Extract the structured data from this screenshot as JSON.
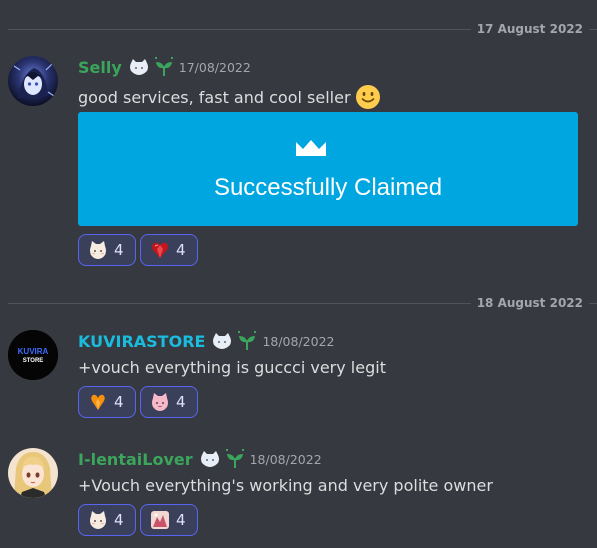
{
  "dividers": [
    {
      "date": "17 August 2022"
    },
    {
      "date": "18 August 2022"
    }
  ],
  "messages": [
    {
      "username": "Selly",
      "username_color": "#3ba55c",
      "timestamp": "17/08/2022",
      "text": "good services, fast and cool seller",
      "emoji": "slightly-smiling-face",
      "embed": {
        "title": "Successfully Claimed",
        "color": "#00a6df",
        "icon": "crown-icon"
      },
      "reactions": [
        {
          "emoji": "cat-face",
          "count": "4"
        },
        {
          "emoji": "red-heart-gem",
          "count": "4"
        }
      ]
    },
    {
      "username": "KUVIRASTORE",
      "username_color": "#1abcde",
      "avatar_text": [
        "KUVIRA",
        "STORE"
      ],
      "timestamp": "18/08/2022",
      "text": "+vouch everything is guccci very legit",
      "reactions": [
        {
          "emoji": "orange-heart",
          "count": "4"
        },
        {
          "emoji": "pink-cat",
          "count": "4"
        }
      ]
    },
    {
      "username": "I-lentaiLover",
      "username_color": "#3ba55c",
      "timestamp": "18/08/2022",
      "text": "+Vouch everything's working and very polite owner",
      "reactions": [
        {
          "emoji": "cat-face",
          "count": "4"
        },
        {
          "emoji": "anime-sticker",
          "count": "4"
        }
      ]
    }
  ]
}
